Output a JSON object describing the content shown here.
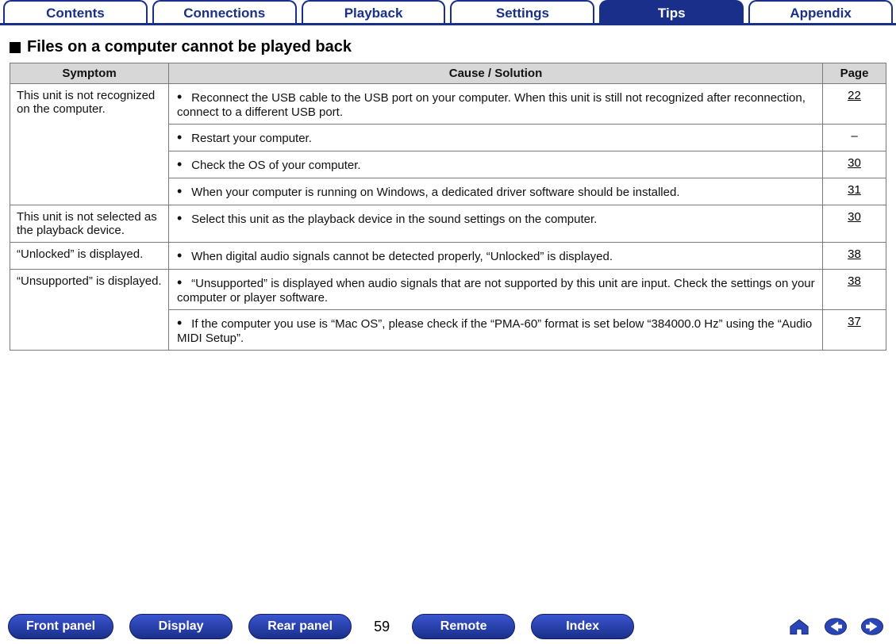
{
  "nav": {
    "tabs": [
      {
        "label": "Contents",
        "active": false
      },
      {
        "label": "Connections",
        "active": false
      },
      {
        "label": "Playback",
        "active": false
      },
      {
        "label": "Settings",
        "active": false
      },
      {
        "label": "Tips",
        "active": true
      },
      {
        "label": "Appendix",
        "active": false
      }
    ]
  },
  "section": {
    "title": "Files on a computer cannot be played back"
  },
  "table": {
    "headers": {
      "symptom": "Symptom",
      "cause": "Cause / Solution",
      "page": "Page"
    },
    "groups": [
      {
        "symptom": "This unit is not recognized on the computer.",
        "rows": [
          {
            "cause": "Reconnect the USB cable to the USB port on your computer. When this unit is still not recognized after reconnection, connect to a different USB port.",
            "page": "22",
            "link": true
          },
          {
            "cause": "Restart your computer.",
            "page": "–",
            "link": false
          },
          {
            "cause": "Check the OS of your computer.",
            "page": "30",
            "link": true
          },
          {
            "cause": "When your computer is running on Windows, a dedicated driver software should be installed.",
            "page": "31",
            "link": true
          }
        ]
      },
      {
        "symptom": "This unit is not selected as the playback device.",
        "rows": [
          {
            "cause": "Select this unit as the playback device in the sound settings on the computer.",
            "page": "30",
            "link": true
          }
        ]
      },
      {
        "symptom": "“Unlocked” is displayed.",
        "rows": [
          {
            "cause": "When digital audio signals cannot be detected properly, “Unlocked” is displayed.",
            "page": "38",
            "link": true
          }
        ]
      },
      {
        "symptom": "“Unsupported” is displayed.",
        "rows": [
          {
            "cause": "“Unsupported” is displayed when audio signals that are not supported by this unit are input. Check the settings on your computer or player software.",
            "page": "38",
            "link": true
          },
          {
            "cause": "If the computer you use is “Mac OS”, please check if the “PMA-60” format is set below “384000.0 Hz” using the “Audio MIDI Setup”.",
            "page": "37",
            "link": true
          }
        ]
      }
    ]
  },
  "bottom": {
    "buttons": [
      "Front panel",
      "Display",
      "Rear panel",
      "Remote",
      "Index"
    ],
    "page_number": "59",
    "icons": {
      "home": "home-icon",
      "prev": "arrow-left-icon",
      "next": "arrow-right-icon"
    }
  }
}
